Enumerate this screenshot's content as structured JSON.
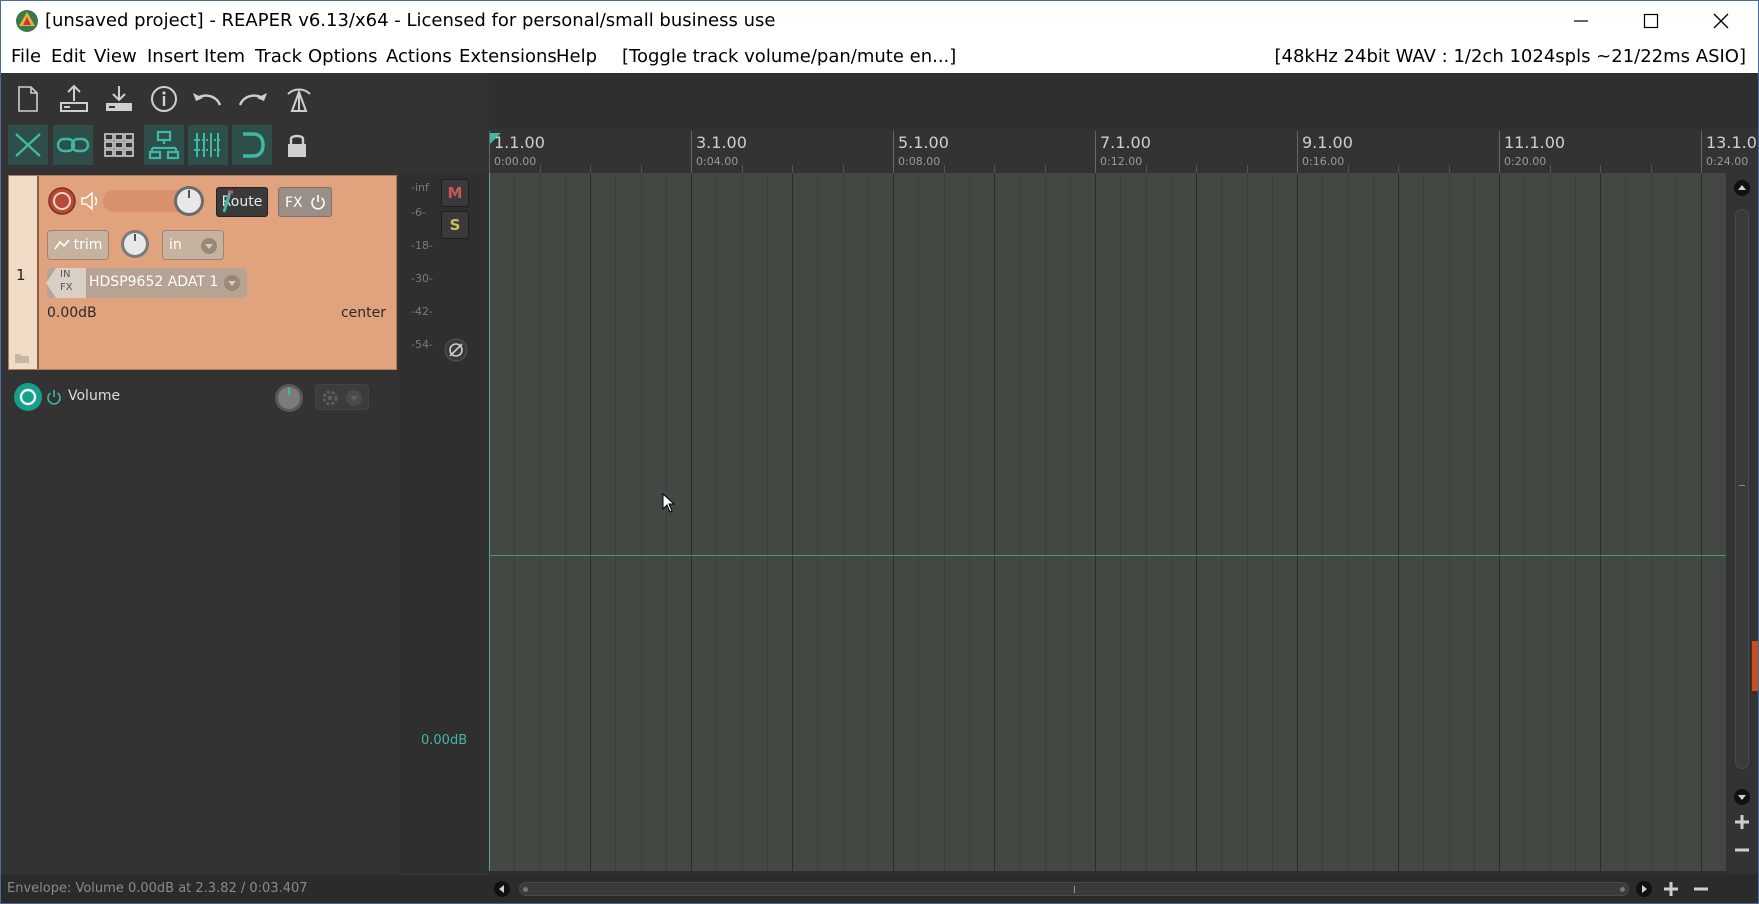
{
  "window": {
    "title": "[unsaved project] - REAPER v6.13/x64 - Licensed for personal/small business use"
  },
  "menu": {
    "items": [
      "File",
      "Edit",
      "View",
      "Insert",
      "Item",
      "Track",
      "Options",
      "Actions",
      "Extensions",
      "Help"
    ],
    "action_label": "[Toggle track volume/pan/mute en...]",
    "status_info": "[48kHz 24bit WAV : 1/2ch 1024spls ~21/22ms ASIO]"
  },
  "track": {
    "number": "1",
    "route_label": "Route",
    "fx_label": "FX",
    "trim_label": "trim",
    "in_label": "in",
    "input_device": "HDSP9652 ADAT 1",
    "input_tag_top": "IN",
    "input_tag_bottom": "FX",
    "volume": "0.00dB",
    "pan": "center"
  },
  "meter": {
    "scale": [
      "-inf",
      "-6-",
      "-18-",
      "-30-",
      "-42-",
      "-54-"
    ],
    "mute_label": "M",
    "solo_label": "S",
    "master_volume": "0.00dB"
  },
  "envelope": {
    "label": "Volume"
  },
  "ruler": {
    "markers": [
      {
        "bar": "1.1.00",
        "time": "0:00.00"
      },
      {
        "bar": "3.1.00",
        "time": "0:04.00"
      },
      {
        "bar": "5.1.00",
        "time": "0:08.00"
      },
      {
        "bar": "7.1.00",
        "time": "0:12.00"
      },
      {
        "bar": "9.1.00",
        "time": "0:16.00"
      },
      {
        "bar": "11.1.00",
        "time": "0:20.00"
      },
      {
        "bar": "13.1.0",
        "time": "0:24.00"
      }
    ]
  },
  "status": {
    "text": "Envelope: Volume 0.00dB at 2.3.82 / 0:03.407"
  },
  "colors": {
    "track_color": "#e0a37e",
    "accent": "#3fb9a6",
    "arrange_bg": "#434843"
  }
}
